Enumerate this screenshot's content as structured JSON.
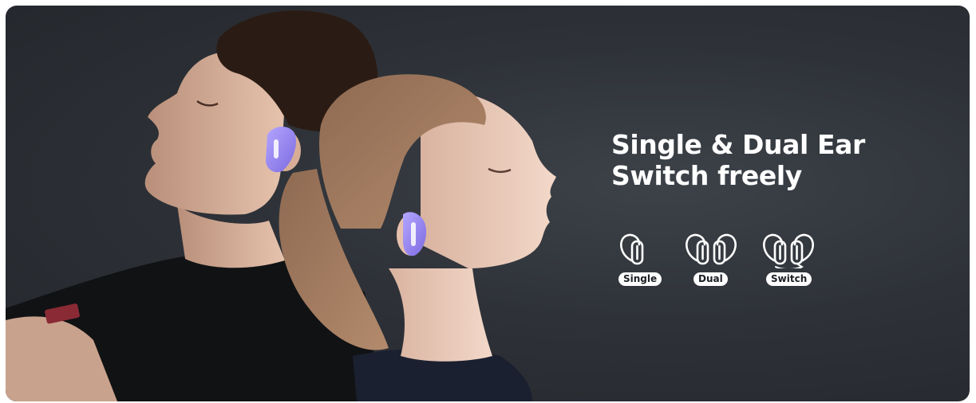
{
  "banner": {
    "headline_line1": "Single & Dual Ear",
    "headline_line2": "Switch freely",
    "modes": [
      {
        "label": "Single",
        "icon": "single-earbud-icon"
      },
      {
        "label": "Dual",
        "icon": "dual-earbuds-icon"
      },
      {
        "label": "Switch",
        "icon": "switch-earbuds-icon"
      }
    ],
    "colors": {
      "background": "#2e3238",
      "text": "#ffffff",
      "earbud": "#9b8bf0"
    }
  }
}
